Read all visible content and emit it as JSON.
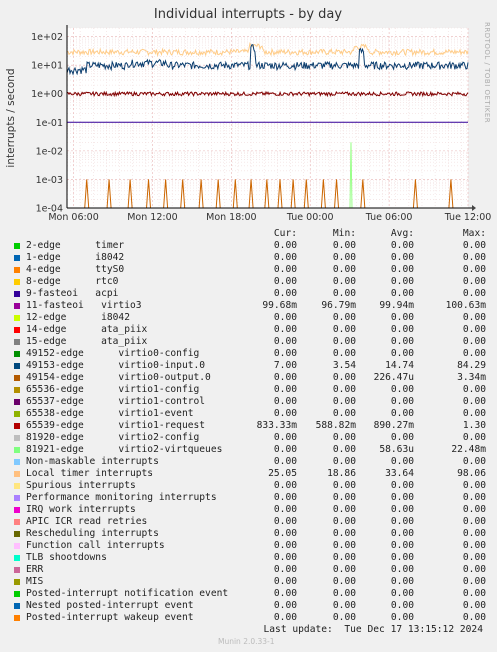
{
  "chart_data": {
    "type": "line",
    "title": "Individual interrupts - by day",
    "ylabel": "interrupts / second",
    "side_text": "RRDTOOL / TOBI OETIKER",
    "y_scale": "log",
    "ylim": [
      0.0001,
      200
    ],
    "y_ticks": [
      "1e+02",
      "1e+01",
      "1e+00",
      "1e-01",
      "1e-02",
      "1e-03",
      "1e-04"
    ],
    "x_ticks": [
      "Mon 06:00",
      "Mon 12:00",
      "Mon 18:00",
      "Tue 00:00",
      "Tue 06:00",
      "Tue 12:00"
    ],
    "grid": true,
    "series": [
      {
        "name": "Local timer interrupts",
        "color": "#ffcc88",
        "approx_level": 30
      },
      {
        "name": "65539-edge virtio1-request",
        "color": "#0b3d6e",
        "approx_level": 10
      },
      {
        "name": "49153-edge virtio0-input.0",
        "color": "#800000",
        "approx_level": 1
      },
      {
        "name": "11-fasteoi virtio3",
        "color": "#330099",
        "approx_level": 0.1
      },
      {
        "name": "49154-edge virtio0-output.0",
        "color": "#cc6600",
        "approx_level": 0.0001,
        "spike_level": 0.001
      },
      {
        "name": "81921-edge virtio2-virtqueues",
        "color": "#99ff88",
        "approx_level": 0.0001,
        "spike_level": 0.02
      }
    ]
  },
  "legend": {
    "headers": {
      "cur": "Cur:",
      "min": "Min:",
      "avg": "Avg:",
      "max": "Max:"
    },
    "rows": [
      {
        "name": "2-edge      timer",
        "color": "#00cc00",
        "cur": "0.00",
        "min": "0.00",
        "avg": "0.00",
        "max": "0.00"
      },
      {
        "name": "1-edge      i8042",
        "color": "#0066b3",
        "cur": "0.00",
        "min": "0.00",
        "avg": "0.00",
        "max": "0.00"
      },
      {
        "name": "4-edge      ttyS0",
        "color": "#ff8000",
        "cur": "0.00",
        "min": "0.00",
        "avg": "0.00",
        "max": "0.00"
      },
      {
        "name": "8-edge      rtc0",
        "color": "#ffcc00",
        "cur": "0.00",
        "min": "0.00",
        "avg": "0.00",
        "max": "0.00"
      },
      {
        "name": "9-fasteoi   acpi",
        "color": "#330099",
        "cur": "0.00",
        "min": "0.00",
        "avg": "0.00",
        "max": "0.00"
      },
      {
        "name": "11-fasteoi   virtio3",
        "color": "#990099",
        "cur": "99.68m",
        "min": "96.79m",
        "avg": "99.94m",
        "max": "100.63m"
      },
      {
        "name": "12-edge      i8042",
        "color": "#ccff00",
        "cur": "0.00",
        "min": "0.00",
        "avg": "0.00",
        "max": "0.00"
      },
      {
        "name": "14-edge      ata_piix",
        "color": "#ff0000",
        "cur": "0.00",
        "min": "0.00",
        "avg": "0.00",
        "max": "0.00"
      },
      {
        "name": "15-edge      ata_piix",
        "color": "#808080",
        "cur": "0.00",
        "min": "0.00",
        "avg": "0.00",
        "max": "0.00"
      },
      {
        "name": "49152-edge      virtio0-config",
        "color": "#008f00",
        "cur": "0.00",
        "min": "0.00",
        "avg": "0.00",
        "max": "0.00"
      },
      {
        "name": "49153-edge      virtio0-input.0",
        "color": "#00487d",
        "cur": "7.00",
        "min": "3.54",
        "avg": "14.74",
        "max": "84.29"
      },
      {
        "name": "49154-edge      virtio0-output.0",
        "color": "#b35a00",
        "cur": "0.00",
        "min": "0.00",
        "avg": "226.47u",
        "max": "3.34m"
      },
      {
        "name": "65536-edge      virtio1-config",
        "color": "#b38f00",
        "cur": "0.00",
        "min": "0.00",
        "avg": "0.00",
        "max": "0.00"
      },
      {
        "name": "65537-edge      virtio1-control",
        "color": "#6b006b",
        "cur": "0.00",
        "min": "0.00",
        "avg": "0.00",
        "max": "0.00"
      },
      {
        "name": "65538-edge      virtio1-event",
        "color": "#8fb300",
        "cur": "0.00",
        "min": "0.00",
        "avg": "0.00",
        "max": "0.00"
      },
      {
        "name": "65539-edge      virtio1-request",
        "color": "#b30000",
        "cur": "833.33m",
        "min": "588.82m",
        "avg": "890.27m",
        "max": "1.30"
      },
      {
        "name": "81920-edge      virtio2-config",
        "color": "#bebebe",
        "cur": "0.00",
        "min": "0.00",
        "avg": "0.00",
        "max": "0.00"
      },
      {
        "name": "81921-edge      virtio2-virtqueues",
        "color": "#80ff80",
        "cur": "0.00",
        "min": "0.00",
        "avg": "58.63u",
        "max": "22.48m"
      },
      {
        "name": "Non-maskable interrupts",
        "color": "#80c9ff",
        "cur": "0.00",
        "min": "0.00",
        "avg": "0.00",
        "max": "0.00"
      },
      {
        "name": "Local timer interrupts",
        "color": "#ffc080",
        "cur": "25.05",
        "min": "18.86",
        "avg": "33.64",
        "max": "98.06"
      },
      {
        "name": "Spurious interrupts",
        "color": "#ffe680",
        "cur": "0.00",
        "min": "0.00",
        "avg": "0.00",
        "max": "0.00"
      },
      {
        "name": "Performance monitoring interrupts",
        "color": "#aa80ff",
        "cur": "0.00",
        "min": "0.00",
        "avg": "0.00",
        "max": "0.00"
      },
      {
        "name": "IRQ work interrupts",
        "color": "#ee00cc",
        "cur": "0.00",
        "min": "0.00",
        "avg": "0.00",
        "max": "0.00"
      },
      {
        "name": "APIC ICR read retries",
        "color": "#ff8080",
        "cur": "0.00",
        "min": "0.00",
        "avg": "0.00",
        "max": "0.00"
      },
      {
        "name": "Rescheduling interrupts",
        "color": "#666600",
        "cur": "0.00",
        "min": "0.00",
        "avg": "0.00",
        "max": "0.00"
      },
      {
        "name": "Function call interrupts",
        "color": "#ffbfff",
        "cur": "0.00",
        "min": "0.00",
        "avg": "0.00",
        "max": "0.00"
      },
      {
        "name": "TLB shootdowns",
        "color": "#00ffcc",
        "cur": "0.00",
        "min": "0.00",
        "avg": "0.00",
        "max": "0.00"
      },
      {
        "name": "ERR",
        "color": "#cc6699",
        "cur": "0.00",
        "min": "0.00",
        "avg": "0.00",
        "max": "0.00"
      },
      {
        "name": "MIS",
        "color": "#999900",
        "cur": "0.00",
        "min": "0.00",
        "avg": "0.00",
        "max": "0.00"
      },
      {
        "name": "Posted-interrupt notification event",
        "color": "#00cc00",
        "cur": "0.00",
        "min": "0.00",
        "avg": "0.00",
        "max": "0.00"
      },
      {
        "name": "Nested posted-interrupt event",
        "color": "#0066b3",
        "cur": "0.00",
        "min": "0.00",
        "avg": "0.00",
        "max": "0.00"
      },
      {
        "name": "Posted-interrupt wakeup event",
        "color": "#ff8000",
        "cur": "0.00",
        "min": "0.00",
        "avg": "0.00",
        "max": "0.00"
      }
    ]
  },
  "footer": {
    "last_update": "Last update:  Tue Dec 17 13:15:12 2024",
    "munin_version": "Munin 2.0.33-1"
  }
}
